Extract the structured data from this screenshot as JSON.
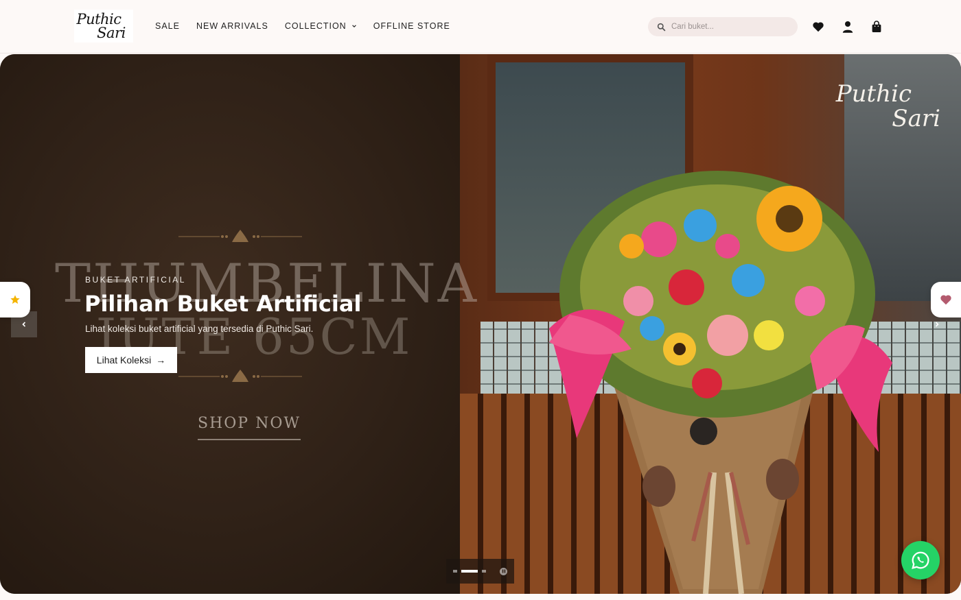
{
  "brand": {
    "logo_line1": "Puthic",
    "logo_line2": "Sari",
    "hero_mark_line1": "Puthic",
    "hero_mark_line2": "Sari"
  },
  "nav": {
    "items": [
      {
        "label": "SALE"
      },
      {
        "label": "NEW ARRIVALS"
      },
      {
        "label": "COLLECTION",
        "has_dropdown": true
      },
      {
        "label": "OFFLINE STORE"
      }
    ]
  },
  "search": {
    "placeholder": "Cari buket..."
  },
  "header_icons": [
    "heart-icon",
    "user-icon",
    "bag-icon"
  ],
  "hero": {
    "eyebrow": "BUKET ARTIFICIAL",
    "headline": "Pilihan Buket Artificial",
    "subtext": "Lihat koleksi buket artificial yang tersedia di Puthic Sari.",
    "cta_label": "Lihat Koleksi",
    "cta_arrow": "→",
    "banner_title_line1": "THUMBELINA",
    "banner_title_line2": "JUTE 65CM",
    "banner_shop_now": "SHOP NOW",
    "slides_count": 3,
    "active_slide": 2
  },
  "colors": {
    "accent": "#25d366",
    "header_bg": "#fdf9f7",
    "search_bg": "#f3e9e7",
    "star": "#f4b400",
    "heart": "#b35a6e"
  }
}
